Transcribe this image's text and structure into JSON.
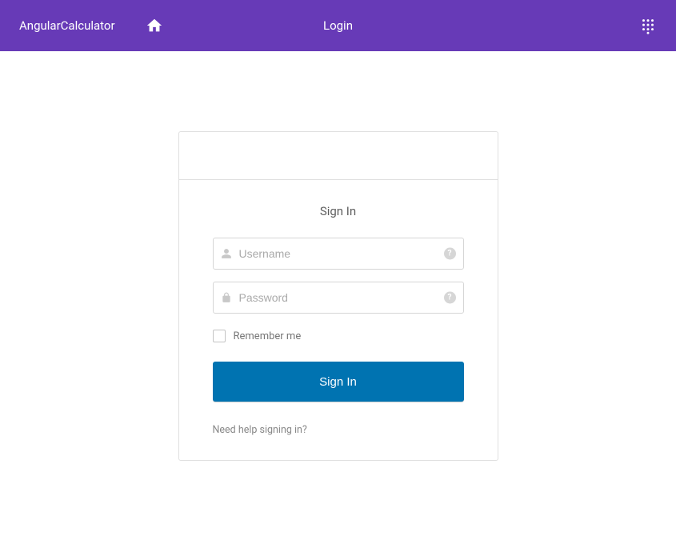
{
  "header": {
    "app_title": "AngularCalculator",
    "login_label": "Login"
  },
  "login": {
    "title": "Sign In",
    "username_placeholder": "Username",
    "password_placeholder": "Password",
    "remember_label": "Remember me",
    "signin_button": "Sign In",
    "help_link": "Need help signing in?"
  }
}
